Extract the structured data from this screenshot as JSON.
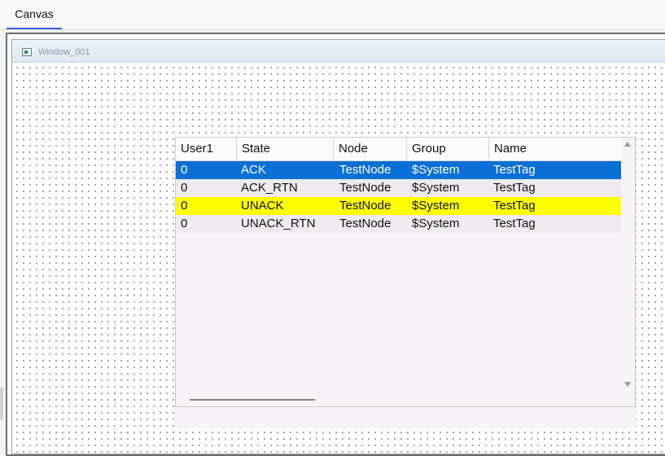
{
  "tab": {
    "label": "Canvas"
  },
  "window": {
    "title": "Window_001"
  },
  "grid": {
    "columns": [
      "User1",
      "State",
      "Node",
      "Group",
      "Name"
    ],
    "rows": [
      {
        "cells": [
          "0",
          "ACK",
          "TestNode",
          "$System",
          "TestTag"
        ],
        "bg": "#0a6fd6",
        "fg": "#ffffff"
      },
      {
        "cells": [
          "0",
          "ACK_RTN",
          "TestNode",
          "$System",
          "TestTag"
        ],
        "bg": "#eeeaee",
        "fg": "#111111"
      },
      {
        "cells": [
          "0",
          "UNACK",
          "TestNode",
          "$System",
          "TestTag"
        ],
        "bg": "#ffff00",
        "fg": "#111111"
      },
      {
        "cells": [
          "0",
          "UNACK_RTN",
          "TestNode",
          "$System",
          "TestTag"
        ],
        "bg": "#eeeaee",
        "fg": "#111111"
      }
    ]
  }
}
